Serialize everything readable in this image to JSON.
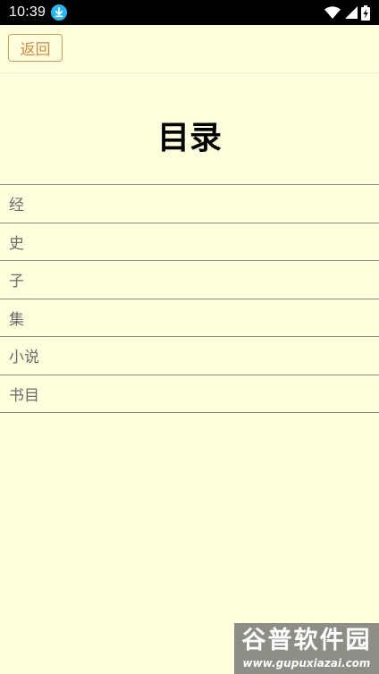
{
  "status_bar": {
    "time": "10:39",
    "icons": [
      "download-icon",
      "wifi-icon",
      "signal-icon",
      "battery-charging-icon"
    ]
  },
  "header": {
    "back_label": "返回"
  },
  "page": {
    "title": "目录"
  },
  "catalog": {
    "items": [
      {
        "label": "经"
      },
      {
        "label": "史"
      },
      {
        "label": "子"
      },
      {
        "label": "集"
      },
      {
        "label": "小说"
      },
      {
        "label": "书目"
      }
    ]
  },
  "watermark": {
    "main": "谷普软件园",
    "sub": "www.gupuxiazai.com"
  },
  "colors": {
    "background": "#FFFFDD",
    "accent": "#D08A45",
    "divider": "#8A8A80",
    "item_text": "#6B6B6B"
  }
}
